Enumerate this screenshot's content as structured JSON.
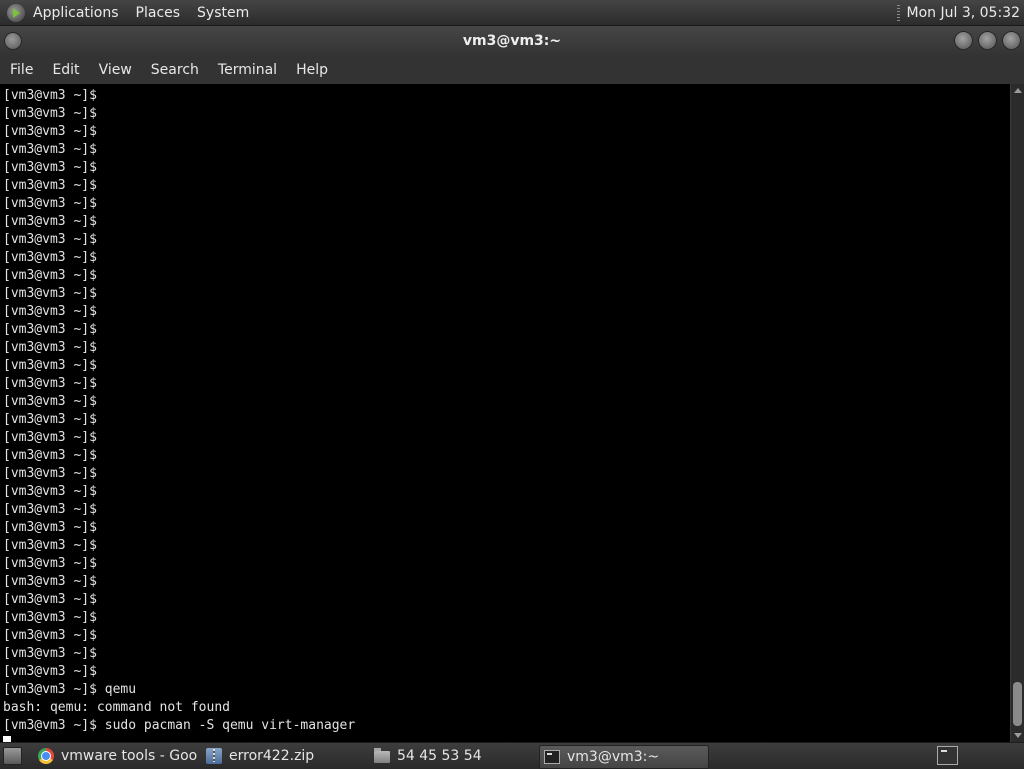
{
  "top_panel": {
    "menus": [
      "Applications",
      "Places",
      "System"
    ],
    "clock": "Mon Jul  3, 05:32"
  },
  "window": {
    "title": "vm3@vm3:~"
  },
  "menubar": {
    "items": [
      "File",
      "Edit",
      "View",
      "Search",
      "Terminal",
      "Help"
    ]
  },
  "terminal": {
    "lines": [
      "[vm3@vm3 ~]$",
      "[vm3@vm3 ~]$",
      "[vm3@vm3 ~]$",
      "[vm3@vm3 ~]$",
      "[vm3@vm3 ~]$",
      "[vm3@vm3 ~]$",
      "[vm3@vm3 ~]$",
      "[vm3@vm3 ~]$",
      "[vm3@vm3 ~]$",
      "[vm3@vm3 ~]$",
      "[vm3@vm3 ~]$",
      "[vm3@vm3 ~]$",
      "[vm3@vm3 ~]$",
      "[vm3@vm3 ~]$",
      "[vm3@vm3 ~]$",
      "[vm3@vm3 ~]$",
      "[vm3@vm3 ~]$",
      "[vm3@vm3 ~]$",
      "[vm3@vm3 ~]$",
      "[vm3@vm3 ~]$",
      "[vm3@vm3 ~]$",
      "[vm3@vm3 ~]$",
      "[vm3@vm3 ~]$",
      "[vm3@vm3 ~]$",
      "[vm3@vm3 ~]$",
      "[vm3@vm3 ~]$",
      "[vm3@vm3 ~]$",
      "[vm3@vm3 ~]$",
      "[vm3@vm3 ~]$",
      "[vm3@vm3 ~]$",
      "[vm3@vm3 ~]$",
      "[vm3@vm3 ~]$",
      "[vm3@vm3 ~]$",
      "[vm3@vm3 ~]$ qemu",
      "bash: qemu: command not found",
      "[vm3@vm3 ~]$ sudo pacman -S qemu virt-manager"
    ]
  },
  "taskbar": {
    "tasks": [
      {
        "label": "vmware tools - Goo...",
        "icon": "chrome-icon"
      },
      {
        "label": "error422.zip",
        "icon": "archive-icon"
      },
      {
        "label": "54 45 53 54",
        "icon": "folder-icon"
      },
      {
        "label": "vm3@vm3:~",
        "icon": "terminal-icon"
      }
    ]
  }
}
